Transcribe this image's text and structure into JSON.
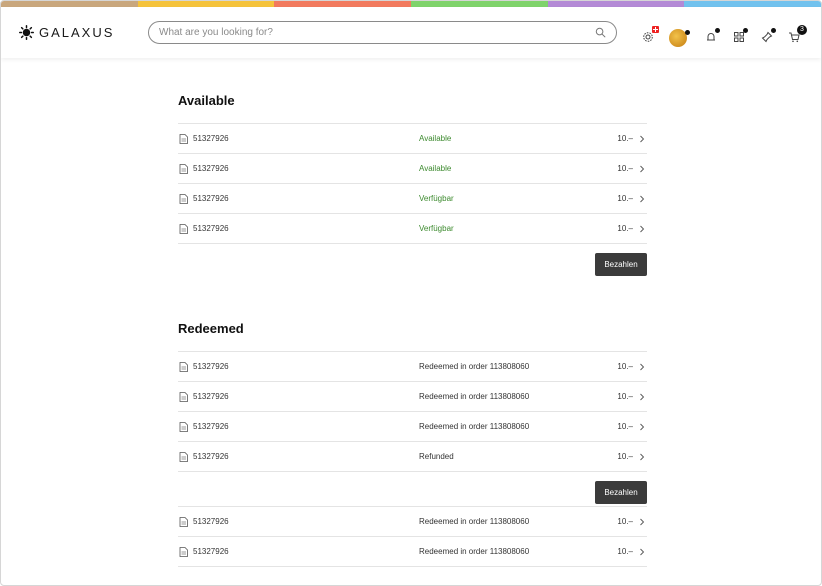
{
  "stripe_colors": [
    "#c9a77d",
    "#f5c33b",
    "#f27a5e",
    "#7fd36b",
    "#b48ad6",
    "#72c2ee"
  ],
  "header": {
    "logo_text": "GALAXUS",
    "search_placeholder": "What are you looking for?",
    "cart_count": "3"
  },
  "sections": {
    "available": {
      "title": "Available",
      "rows": [
        {
          "id": "51327926",
          "status": "Available",
          "price": "10.–"
        },
        {
          "id": "51327926",
          "status": "Available",
          "price": "10.–"
        },
        {
          "id": "51327926",
          "status": "Verfügbar",
          "price": "10.–"
        },
        {
          "id": "51327926",
          "status": "Verfügbar",
          "price": "10.–"
        }
      ],
      "button": "Bezahlen"
    },
    "redeemed": {
      "title": "Redeemed",
      "rows": [
        {
          "id": "51327926",
          "status": "Redeemed in order 113808060",
          "price": "10.–"
        },
        {
          "id": "51327926",
          "status": "Redeemed in order 113808060",
          "price": "10.–"
        },
        {
          "id": "51327926",
          "status": "Redeemed in order 113808060",
          "price": "10.–"
        },
        {
          "id": "51327926",
          "status": "Refunded",
          "price": "10.–"
        }
      ],
      "button": "Bezahlen",
      "rows_after": [
        {
          "id": "51327926",
          "status": "Redeemed in order 113808060",
          "price": "10.–"
        },
        {
          "id": "51327926",
          "status": "Redeemed in order 113808060",
          "price": "10.–"
        }
      ]
    }
  }
}
